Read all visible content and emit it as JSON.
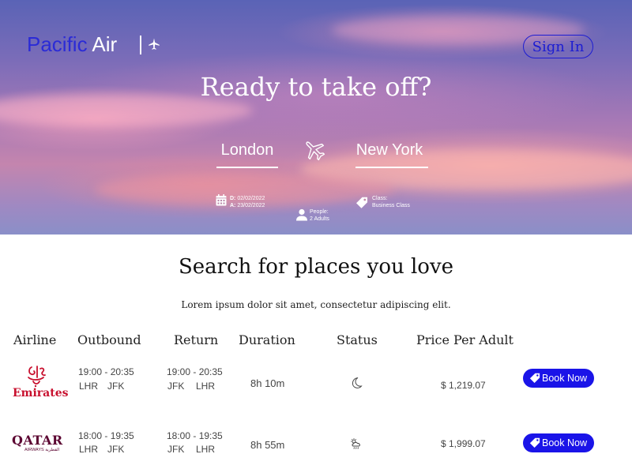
{
  "brand": {
    "name_primary": "Pacific",
    "name_secondary": "Air"
  },
  "header": {
    "sign_in_label": "Sign In"
  },
  "hero": {
    "title": "Ready to take off?",
    "from_city": "London",
    "to_city": "New York",
    "dates": {
      "depart_label": "D:",
      "depart_value": "02/02/2022",
      "arrive_label": "A:",
      "arrive_value": "23/02/2022"
    },
    "people": {
      "label": "People:",
      "value": "2 Adults"
    },
    "class": {
      "label": "Class:",
      "value": "Business Class"
    }
  },
  "section": {
    "title": "Search for places you love",
    "subtitle": "Lorem ipsum dolor sit amet, consectetur adipiscing elit."
  },
  "table": {
    "headers": [
      "Airline",
      "Outbound",
      "Return",
      "Duration",
      "Status",
      "Price Per Adult"
    ],
    "rows": [
      {
        "airline": "Emirates",
        "outbound_time": "19:00 - 20:35",
        "outbound_from": "LHR",
        "outbound_to": "JFK",
        "return_time": "19:00 - 20:35",
        "return_from": "JFK",
        "return_to": "LHR",
        "duration": "8h 10m",
        "status_icon": "moon-icon",
        "price": "$ 1,219.07",
        "book_label": "Book Now"
      },
      {
        "airline": "QATAR",
        "airline_sub": "AIRWAYS القطرية",
        "outbound_time": "18:00 - 19:35",
        "outbound_from": "LHR",
        "outbound_to": "JFK",
        "return_time": "18:00 - 19:35",
        "return_from": "JFK",
        "return_to": "LHR",
        "duration": "8h 55m",
        "status_icon": "rain-cloud-icon",
        "price": "$ 1,999.07",
        "book_label": "Book Now"
      }
    ]
  },
  "colors": {
    "brand_blue": "#1a14e8",
    "logo_blue": "#2b2bd6",
    "emirates_red": "#c8102e",
    "qatar_maroon": "#5c0632"
  }
}
